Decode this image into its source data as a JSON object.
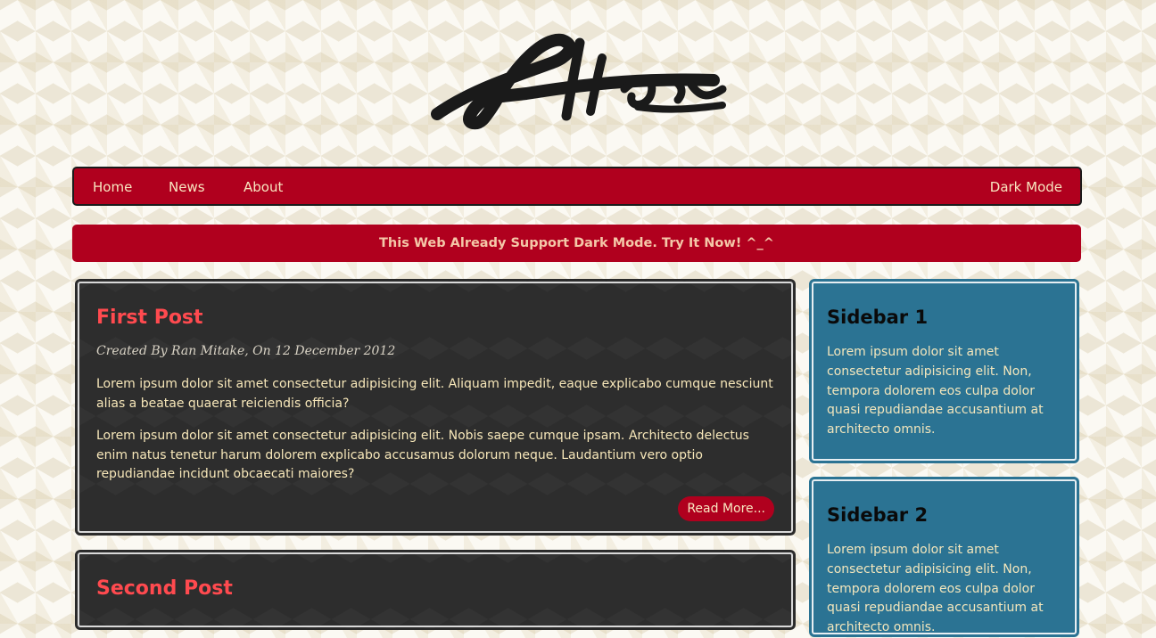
{
  "brand": {
    "logo_text": "Afterglow"
  },
  "nav": {
    "items": [
      {
        "label": "Home"
      },
      {
        "label": "News"
      },
      {
        "label": "About"
      }
    ],
    "dark_mode_label": "Dark Mode"
  },
  "banner": {
    "text": "This Web Already Support Dark Mode. Try It Now! ^_^"
  },
  "posts": [
    {
      "title": "First Post",
      "meta": "Created By Ran Mitake, On 12 December 2012",
      "paragraphs": [
        "Lorem ipsum dolor sit amet consectetur adipisicing elit. Aliquam impedit, eaque explicabo cumque nesciunt alias a beatae quaerat reiciendis officia?",
        "Lorem ipsum dolor sit amet consectetur adipisicing elit. Nobis saepe cumque ipsam. Architecto delectus enim natus tenetur harum dolorem explicabo accusamus dolorum neque. Laudantium vero optio repudiandae incidunt obcaecati maiores?"
      ],
      "read_more_label": "Read More..."
    },
    {
      "title": "Second Post"
    }
  ],
  "sidebars": [
    {
      "title": "Sidebar 1",
      "text": "Lorem ipsum dolor sit amet consectetur adipisicing elit. Non, tempora dolorem eos culpa dolor quasi repudiandae accusantium at architecto omnis."
    },
    {
      "title": "Sidebar 2",
      "text": "Lorem ipsum dolor sit amet consectetur adipisicing elit. Non, tempora dolorem eos culpa dolor quasi repudiandae accusantium at architecto omnis."
    }
  ],
  "colors": {
    "accent": "#b0001e",
    "post_background": "#2d2d2d",
    "post_title": "#ff4a4f",
    "sidebar_background": "#2b7393",
    "text_cream": "#f7e7b9"
  }
}
